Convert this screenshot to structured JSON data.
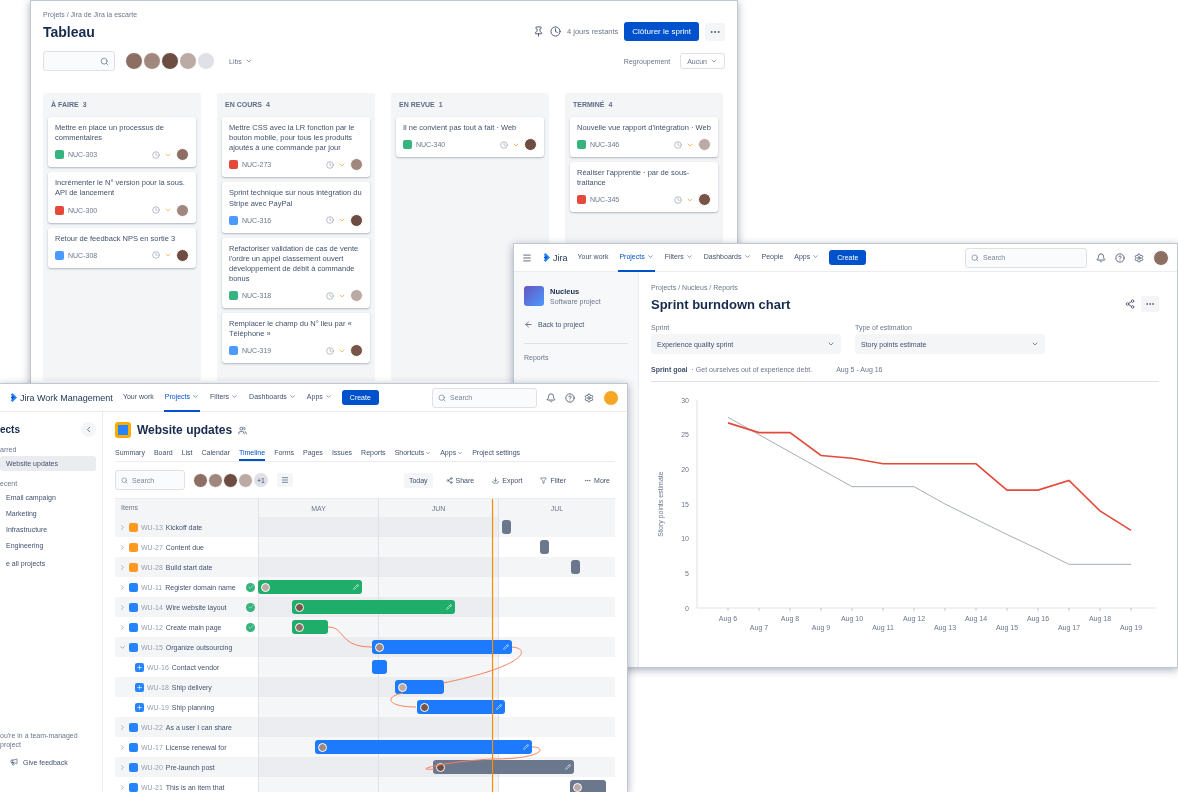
{
  "board": {
    "breadcrumb": "Projets / Jira de Jira la escarte",
    "title": "Tableau",
    "days_left": "4 jours restants",
    "complete_button": "Clôturer le sprint",
    "type_filter": "Libs",
    "group_label": "Regroupement",
    "group_value": "Aucun",
    "columns": [
      {
        "title": "À FAIRE",
        "count": "3",
        "cards": [
          {
            "title": "Mettre en place un processus de commentaires",
            "key": "NUC-303",
            "kind": "story"
          },
          {
            "title": "Incrémenter le N° version pour la sous. API de lancement",
            "key": "NUC-300",
            "kind": "bug"
          },
          {
            "title": "Retour de feedback NPS en sortie 3",
            "key": "NUC-308",
            "kind": "task"
          }
        ]
      },
      {
        "title": "EN COURS",
        "count": "4",
        "cards": [
          {
            "title": "Mettre CSS avec la LR fonction par le bouton mobile, pour tous les produits ajoutés à une commande par jour",
            "key": "NUC-273",
            "kind": "bug"
          },
          {
            "title": "Sprint technique sur nous intégration du Stripe avec PayPal",
            "key": "NUC-316",
            "kind": "task"
          },
          {
            "title": "Refactoriser validation de cas de vente l'ordre un appel classement ouvert développement de débit à commande bonus",
            "key": "NUC-318",
            "kind": "story"
          },
          {
            "title": "Remplacer le champ du N° lieu par « Téléphone »",
            "key": "NUC-319",
            "kind": "task"
          }
        ]
      },
      {
        "title": "EN REVUE",
        "count": "1",
        "cards": [
          {
            "title": "Il ne convient pas tout à fait · Web",
            "key": "NUC-340",
            "kind": "story"
          }
        ]
      },
      {
        "title": "TERMINÉ",
        "count": "4",
        "cards": [
          {
            "title": "Nouvelle vue rapport d'intégration · Web",
            "key": "NUC-346",
            "kind": "story"
          },
          {
            "title": "Réaliser l'apprentie · par de sous-traitance",
            "key": "NUC-345",
            "kind": "bug"
          }
        ]
      }
    ]
  },
  "burndown": {
    "nav": {
      "product": "Jira",
      "create": "Create",
      "search_placeholder": "Search",
      "items": [
        {
          "label": "Your work",
          "selected": false,
          "dropdown": false
        },
        {
          "label": "Projects",
          "selected": true,
          "dropdown": true
        },
        {
          "label": "Filters",
          "selected": false,
          "dropdown": true
        },
        {
          "label": "Dashboards",
          "selected": false,
          "dropdown": true
        },
        {
          "label": "People",
          "selected": false,
          "dropdown": false
        },
        {
          "label": "Apps",
          "selected": false,
          "dropdown": true
        }
      ]
    },
    "sidebar": {
      "project_name": "Nucleus",
      "project_type": "Software project",
      "back": "Back to project",
      "section": "Reports"
    },
    "breadcrumb": "Projects / Nucleus / Reports",
    "title": "Sprint burndown chart",
    "fields": [
      {
        "label": "Sprint",
        "value": "Experience quality sprint"
      },
      {
        "label": "Type of estimation",
        "value": "Story points estimate"
      }
    ],
    "goal_label": "Sprint goal",
    "goal_text": "· Get ourselves out of experience debt.",
    "dates": "Aug 5 - Aug 16",
    "chart_data": {
      "type": "line",
      "ylabel": "Story points estimate",
      "categories": [
        "Aug 6",
        "Aug 7",
        "Aug 8",
        "Aug 9",
        "Aug 10",
        "Aug 11",
        "Aug 12",
        "Aug 13",
        "Aug 14",
        "Aug 15",
        "Aug 16",
        "Aug 17",
        "Aug 18",
        "Aug 19"
      ],
      "yticks": [
        0,
        5,
        10,
        15,
        20,
        25,
        30
      ],
      "ylim": [
        0,
        30
      ],
      "series": [
        {
          "color": "#a5adba",
          "values": [
            27.5,
            25,
            22.5,
            20,
            17.5,
            17.5,
            17.5,
            15,
            12.8,
            10.6,
            8.5,
            6.3,
            6.3,
            6.3
          ]
        },
        {
          "color": "#e5493a",
          "values": [
            26.7,
            25.3,
            25.3,
            22,
            21.6,
            20.8,
            20.8,
            20.8,
            20.8,
            17,
            17,
            18.4,
            14,
            11.2
          ]
        }
      ]
    }
  },
  "timeline": {
    "nav": {
      "product": "Jira Work Management",
      "create": "Create",
      "search_placeholder": "Search",
      "items": [
        {
          "label": "Your work",
          "selected": false,
          "dropdown": false
        },
        {
          "label": "Projects",
          "selected": true,
          "dropdown": true
        },
        {
          "label": "Filters",
          "selected": false,
          "dropdown": true
        },
        {
          "label": "Dashboards",
          "selected": false,
          "dropdown": true
        },
        {
          "label": "Apps",
          "selected": false,
          "dropdown": true
        }
      ]
    },
    "sidebar": {
      "heading": "ects",
      "groups": [
        {
          "label": "arred",
          "items": [
            {
              "label": "Website updates",
              "selected": true
            }
          ]
        },
        {
          "label": "ecent",
          "items": [
            {
              "label": "Email campaign",
              "selected": false
            },
            {
              "label": "Marketing",
              "selected": false
            },
            {
              "label": "Infrastructure",
              "selected": false
            },
            {
              "label": "Engineering",
              "selected": false
            }
          ]
        }
      ],
      "view_all": "e all projects",
      "footer_note": "ou're in a team-managed project",
      "feedback": "Give feedback"
    },
    "project_title": "Website updates",
    "tabs": [
      {
        "label": "Summary",
        "selected": false,
        "dropdown": false
      },
      {
        "label": "Board",
        "selected": false,
        "dropdown": false
      },
      {
        "label": "List",
        "selected": false,
        "dropdown": false
      },
      {
        "label": "Calendar",
        "selected": false,
        "dropdown": false
      },
      {
        "label": "Timeline",
        "selected": true,
        "dropdown": false
      },
      {
        "label": "Forms",
        "selected": false,
        "dropdown": false
      },
      {
        "label": "Pages",
        "selected": false,
        "dropdown": false
      },
      {
        "label": "Issues",
        "selected": false,
        "dropdown": false
      },
      {
        "label": "Reports",
        "selected": false,
        "dropdown": false
      },
      {
        "label": "Shortcuts",
        "selected": false,
        "dropdown": true
      },
      {
        "label": "Apps",
        "selected": false,
        "dropdown": true
      },
      {
        "label": "Project settings",
        "selected": false,
        "dropdown": false
      }
    ],
    "toolbar": {
      "search_placeholder": "Search",
      "more_count": "+1",
      "today": "Today",
      "actions": [
        "Share",
        "Export",
        "Filter",
        "More"
      ]
    },
    "grid": {
      "items_header": "Items",
      "months": [
        "MAY",
        "JUN",
        "JUL"
      ],
      "rows": [
        {
          "key": "WU-13",
          "name": "Kickoff date",
          "kind": "milestone",
          "done": false,
          "color": "#6b778c"
        },
        {
          "key": "WU-27",
          "name": "Content due",
          "kind": "milestone",
          "done": false,
          "color": "#6b778c"
        },
        {
          "key": "WU-28",
          "name": "Build start date",
          "kind": "milestone",
          "done": false,
          "color": "#6b778c"
        },
        {
          "key": "WU-11",
          "name": "Register domain name",
          "kind": "story",
          "done": true,
          "color": "#1fae6a"
        },
        {
          "key": "WU-14",
          "name": "Wire website layout",
          "kind": "story",
          "done": true,
          "color": "#1fae6a"
        },
        {
          "key": "WU-12",
          "name": "Create main page",
          "kind": "story",
          "done": true,
          "color": "#1fae6a"
        },
        {
          "key": "WU-15",
          "name": "Organize outsourcing",
          "kind": "story",
          "done": false,
          "color": "#1d7afc",
          "expanded": true,
          "children": [
            {
              "key": "WU-16",
              "name": "Contact vendor",
              "kind": "subtask",
              "done": false,
              "color": "#1d7afc"
            },
            {
              "key": "WU-18",
              "name": "Ship delivery",
              "kind": "subtask",
              "done": false,
              "color": "#1d7afc"
            },
            {
              "key": "WU-19",
              "name": "Ship planning",
              "kind": "subtask",
              "done": false,
              "color": "#1d7afc"
            }
          ]
        },
        {
          "key": "WU-22",
          "name": "As a user I can share",
          "kind": "story",
          "done": false
        },
        {
          "key": "WU-17",
          "name": "License renewal for",
          "kind": "story",
          "done": false,
          "color": "#1d7afc"
        },
        {
          "key": "WU-20",
          "name": "Pre-launch post",
          "kind": "story",
          "done": false,
          "color": "#6b778c"
        },
        {
          "key": "WU-21",
          "name": "This is an item that",
          "kind": "story",
          "done": false,
          "color": "#6b778c"
        }
      ]
    }
  }
}
